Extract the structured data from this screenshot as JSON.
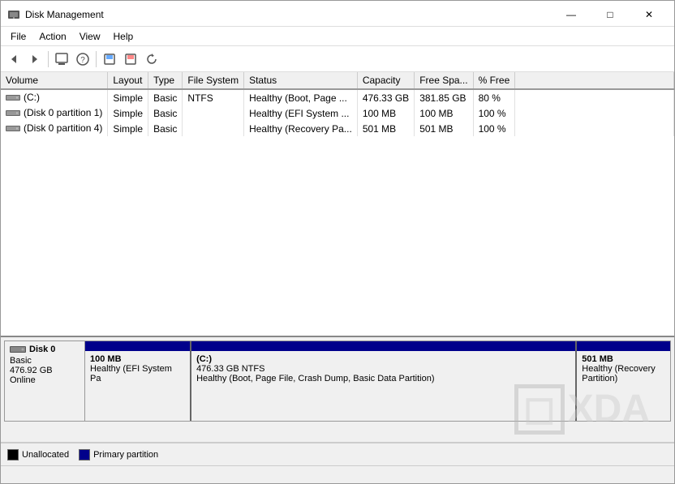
{
  "window": {
    "title": "Disk Management",
    "controls": {
      "minimize": "—",
      "maximize": "□",
      "close": "✕"
    }
  },
  "menu": {
    "items": [
      "File",
      "Action",
      "View",
      "Help"
    ]
  },
  "toolbar": {
    "buttons": [
      {
        "name": "back",
        "icon": "◀"
      },
      {
        "name": "forward",
        "icon": "▶"
      },
      {
        "name": "properties",
        "icon": "⊞"
      },
      {
        "name": "help",
        "icon": "?"
      },
      {
        "name": "new",
        "icon": "□"
      },
      {
        "name": "delete",
        "icon": "✕"
      },
      {
        "name": "refresh",
        "icon": "↺"
      }
    ]
  },
  "table": {
    "columns": [
      "Volume",
      "Layout",
      "Type",
      "File System",
      "Status",
      "Capacity",
      "Free Spa...",
      "% Free"
    ],
    "rows": [
      {
        "volume": "(C:)",
        "layout": "Simple",
        "type": "Basic",
        "fileSystem": "NTFS",
        "status": "Healthy (Boot, Page ...",
        "capacity": "476.33 GB",
        "freeSpace": "381.85 GB",
        "percentFree": "80 %",
        "hasIcon": true
      },
      {
        "volume": "(Disk 0 partition 1)",
        "layout": "Simple",
        "type": "Basic",
        "fileSystem": "",
        "status": "Healthy (EFI System ...",
        "capacity": "100 MB",
        "freeSpace": "100 MB",
        "percentFree": "100 %",
        "hasIcon": true
      },
      {
        "volume": "(Disk 0 partition 4)",
        "layout": "Simple",
        "type": "Basic",
        "fileSystem": "",
        "status": "Healthy (Recovery Pa...",
        "capacity": "501 MB",
        "freeSpace": "501 MB",
        "percentFree": "100 %",
        "hasIcon": true
      }
    ]
  },
  "diskViz": {
    "disk": {
      "name": "Disk 0",
      "type": "Basic",
      "size": "476.92 GB",
      "status": "Online",
      "iconColor": "#555"
    },
    "partitions": [
      {
        "label": "100 MB",
        "sublabel": "Healthy (EFI System Pa",
        "type": "primary",
        "widthPct": 18
      },
      {
        "label": "(C:)",
        "sublabel1": "476.33 GB NTFS",
        "sublabel2": "Healthy (Boot, Page File, Crash Dump, Basic Data Partition)",
        "type": "primary",
        "widthPct": 66
      },
      {
        "label": "501 MB",
        "sublabel": "Healthy (Recovery Partition)",
        "type": "primary",
        "widthPct": 16
      }
    ]
  },
  "legend": {
    "items": [
      {
        "color": "#000",
        "label": "Unallocated"
      },
      {
        "color": "#00008B",
        "label": "Primary partition"
      }
    ]
  },
  "statusBar": {
    "text": ""
  }
}
